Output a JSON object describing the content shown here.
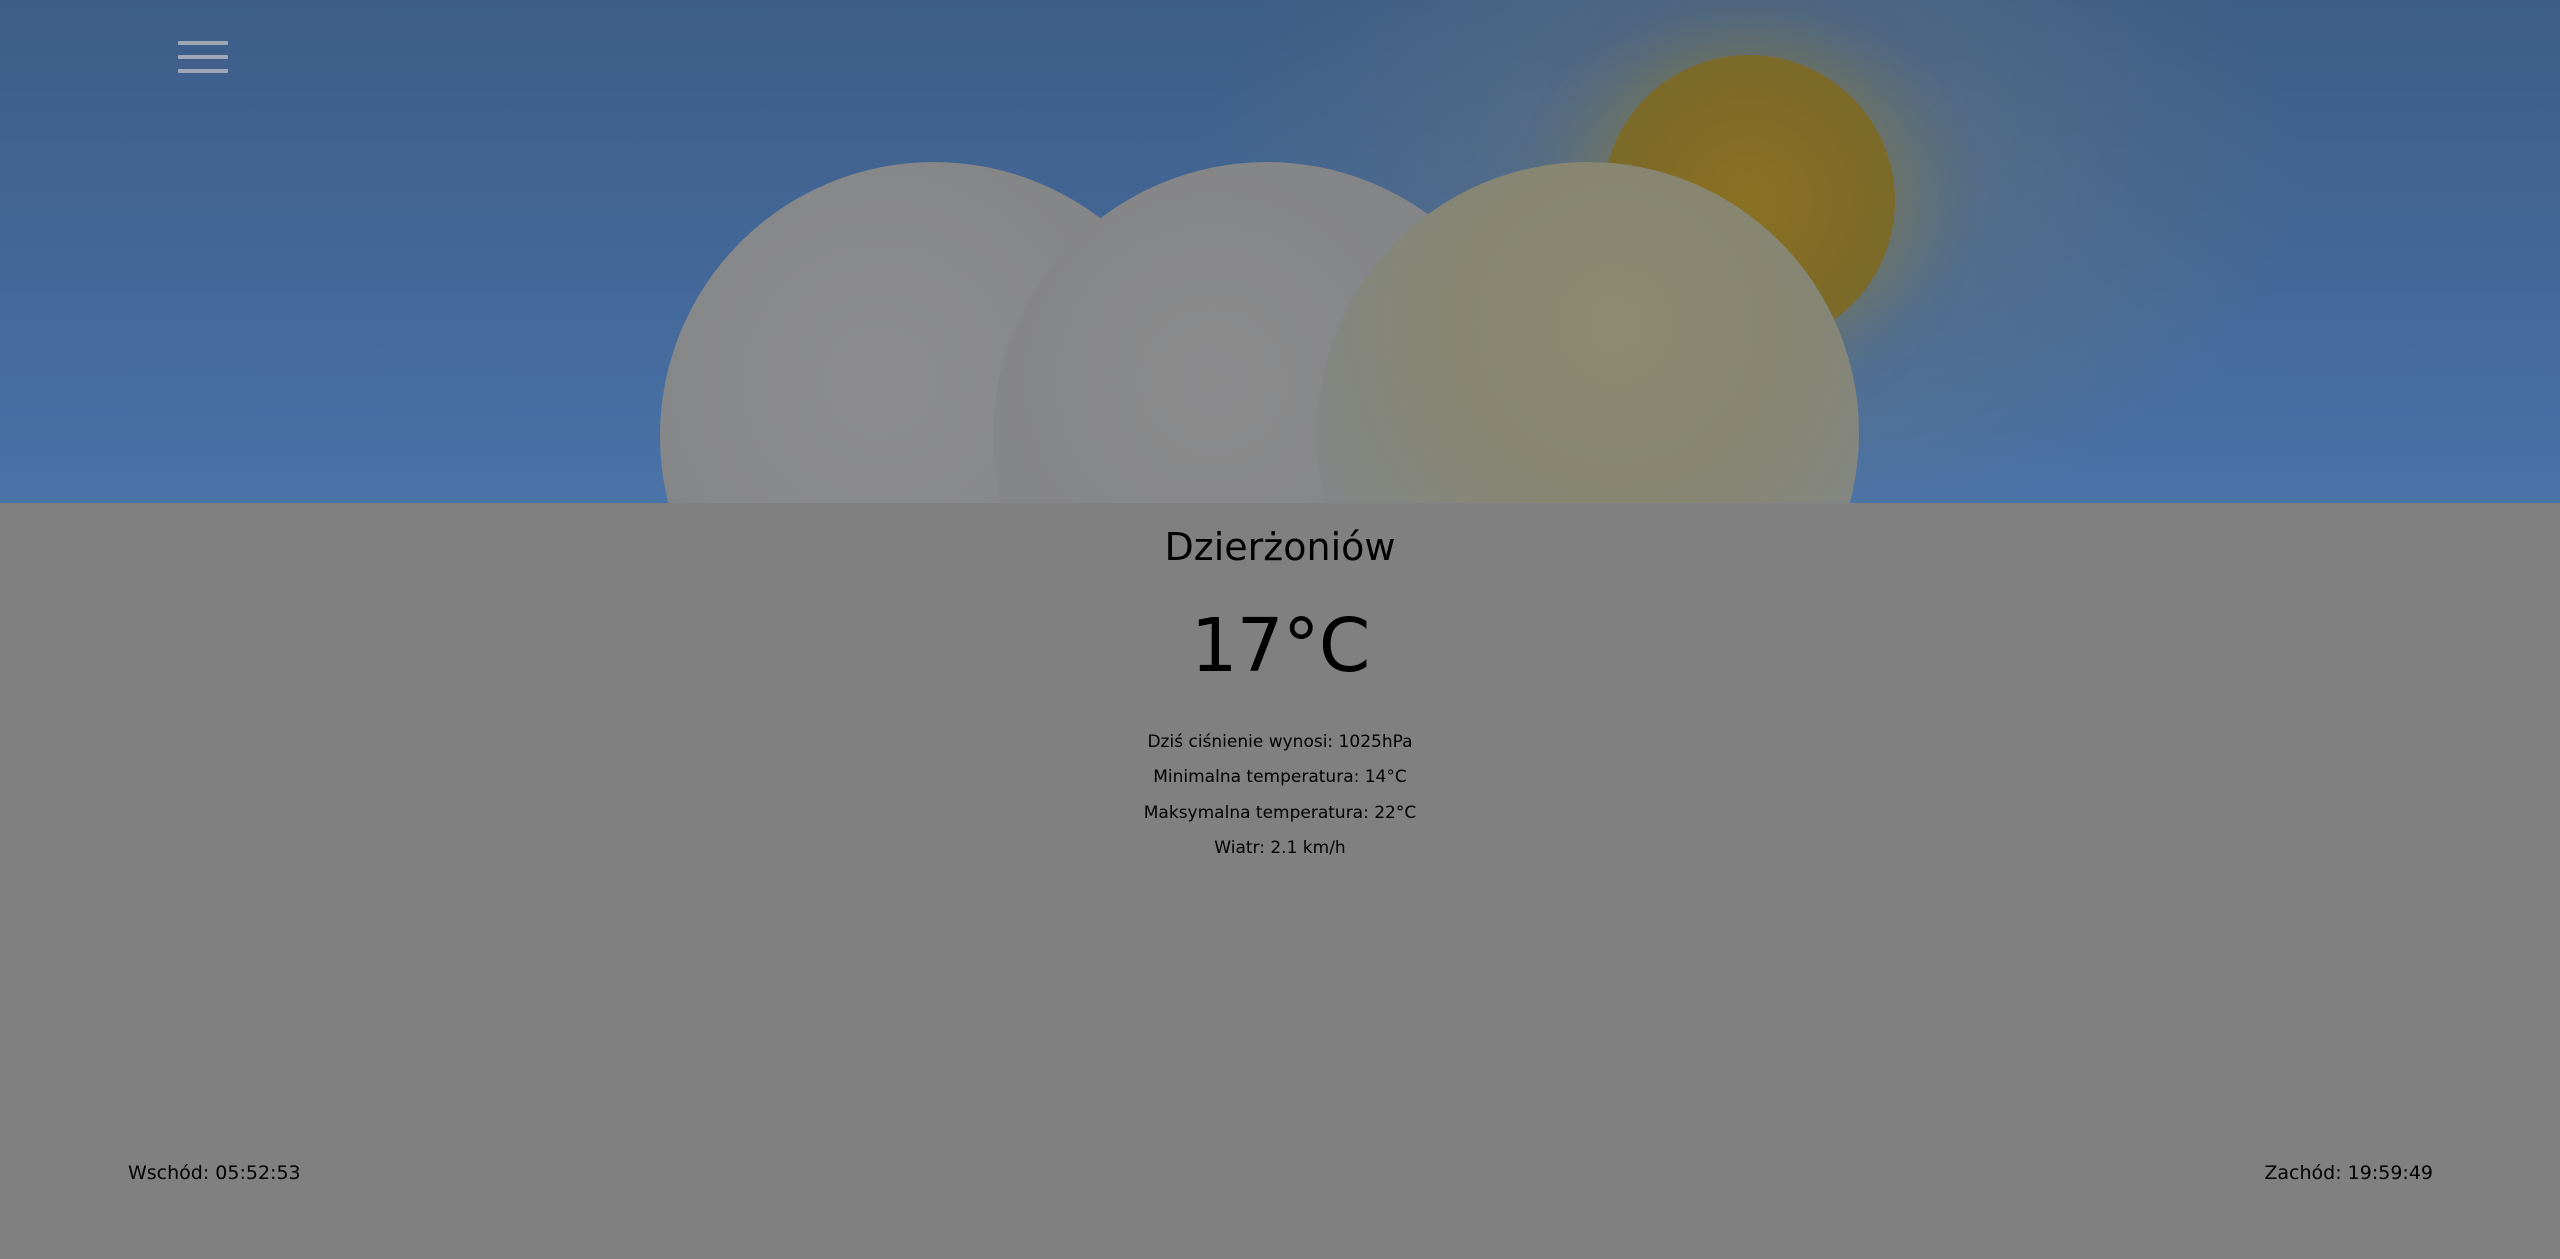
{
  "header": {
    "menu_icon": "hamburger-menu-icon",
    "weather_icon": "partly-cloudy-icon",
    "colors": {
      "sky": "#44699a",
      "sun": "#7d6a28",
      "cloud": "#858688"
    }
  },
  "weather": {
    "city": "Dzierżoniów",
    "temperature": "17°C",
    "pressure": "Dziś ciśnienie wynosi: 1025hPa",
    "temp_min": "Minimalna temperatura: 14°C",
    "temp_max": "Maksymalna temperatura: 22°C",
    "wind": "Wiatr: 2.1 km/h"
  },
  "footer": {
    "sunrise": "Wschód: 05:52:53",
    "sunset": "Zachód: 19:59:49"
  }
}
